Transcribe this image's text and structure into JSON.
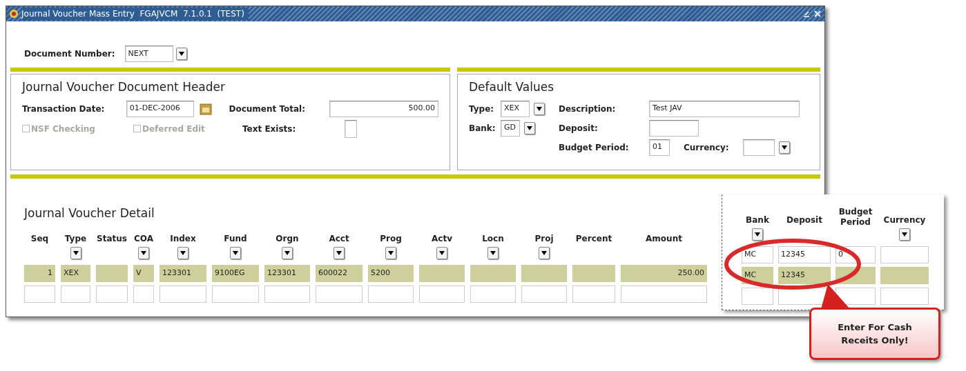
{
  "window": {
    "title": "Journal Voucher Mass Entry  FGAJVCM  7.1.0.1  (TEST)"
  },
  "document_number": {
    "label": "Document Number:",
    "value": "NEXT"
  },
  "header_panel": {
    "title": "Journal Voucher Document Header",
    "transaction_date": {
      "label": "Transaction Date:",
      "value": "01-DEC-2006"
    },
    "document_total": {
      "label": "Document Total:",
      "value": "500.00"
    },
    "text_exists": {
      "label": "Text Exists:"
    },
    "checkboxes": [
      {
        "label": "NSF Checking",
        "checked": false,
        "disabled": true
      },
      {
        "label": "Deferred Edit",
        "checked": false,
        "disabled": true
      }
    ]
  },
  "default_values": {
    "title": "Default Values",
    "type": {
      "label": "Type:",
      "value": "XEX"
    },
    "bank": {
      "label": "Bank:",
      "value": "GD"
    },
    "description": {
      "label": "Description:",
      "value": "Test JAV"
    },
    "deposit": {
      "label": "Deposit:"
    },
    "budget_period": {
      "label": "Budget Period:",
      "value": "01"
    },
    "currency": {
      "label": "Currency:"
    }
  },
  "detail": {
    "title": "Journal Voucher Detail",
    "columns": [
      {
        "label": "Seq",
        "dropdown": false
      },
      {
        "label": "Type",
        "dropdown": true
      },
      {
        "label": "Status",
        "dropdown": false
      },
      {
        "label": "COA",
        "dropdown": true
      },
      {
        "label": "Index",
        "dropdown": true
      },
      {
        "label": "Fund",
        "dropdown": true
      },
      {
        "label": "Orgn",
        "dropdown": true
      },
      {
        "label": "Acct",
        "dropdown": true
      },
      {
        "label": "Prog",
        "dropdown": true
      },
      {
        "label": "Actv",
        "dropdown": true
      },
      {
        "label": "Locn",
        "dropdown": true
      },
      {
        "label": "Proj",
        "dropdown": true
      },
      {
        "label": "Percent",
        "dropdown": false
      },
      {
        "label": "Amount",
        "dropdown": false
      }
    ],
    "rows": [
      {
        "selected": true,
        "cells": [
          "1",
          "XEX",
          "",
          "V",
          "123301",
          "9100EG",
          "123301",
          "600022",
          "5200",
          "",
          "",
          "",
          "",
          "250.00"
        ]
      },
      {
        "selected": false,
        "cells": [
          "",
          "",
          "",
          "",
          "",
          "",
          "",
          "",
          "",
          "",
          "",
          "",
          "",
          ""
        ]
      }
    ]
  },
  "inset": {
    "columns": [
      {
        "label": "Bank",
        "dropdown": true
      },
      {
        "label": "Deposit",
        "dropdown": false
      },
      {
        "label": "Budget Period",
        "dropdown": false
      },
      {
        "label": "Currency",
        "dropdown": true
      }
    ],
    "rows": [
      {
        "selected": false,
        "cells": [
          "MC",
          "12345",
          "0",
          ""
        ]
      },
      {
        "selected": true,
        "cells": [
          "MC",
          "12345",
          "",
          ""
        ]
      },
      {
        "selected": false,
        "cells": [
          "",
          "",
          "",
          ""
        ]
      }
    ]
  },
  "callout": {
    "text": "Enter For Cash Receits Only!"
  }
}
